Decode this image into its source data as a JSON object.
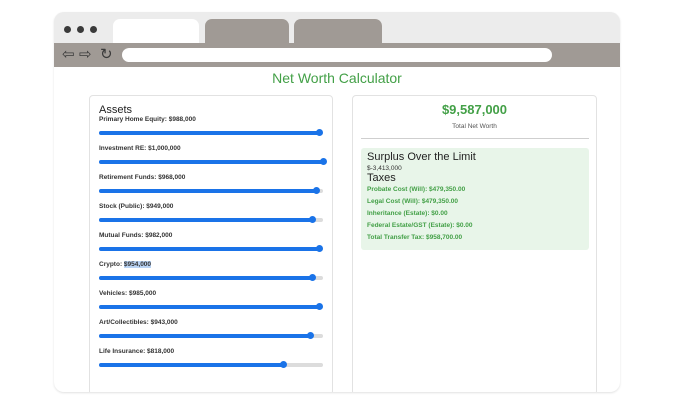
{
  "app": {
    "title": "Net Worth Calculator",
    "accent_color": "#43a047",
    "slider_color": "#1a73e8"
  },
  "browser": {
    "tabs": [
      {
        "state": "active"
      },
      {
        "state": "inactive"
      },
      {
        "state": "inactive"
      }
    ],
    "nav_icons": [
      "back-arrow-icon",
      "forward-arrow-icon",
      "reload-icon"
    ]
  },
  "assets": {
    "heading": "Assets",
    "items": [
      {
        "label": "Primary Home Equity: $988,000",
        "level": 0.98
      },
      {
        "label": "Investment RE: $1,000,000",
        "level": 1.0
      },
      {
        "label": "Retirement Funds: $968,000",
        "level": 0.97
      },
      {
        "label": "Stock (Public): $949,000",
        "level": 0.95
      },
      {
        "label": "Mutual Funds: $982,000",
        "level": 0.98
      },
      {
        "label_prefix": "Crypto: ",
        "label_highlight": "$954,000",
        "level": 0.95
      },
      {
        "label": "Vehicles: $985,000",
        "level": 0.98
      },
      {
        "label": "Art/Collectibles: $943,000",
        "level": 0.94
      },
      {
        "label": "Life Insurance: $818,000",
        "level": 0.82
      }
    ]
  },
  "summary": {
    "net_worth": "$9,587,000",
    "net_worth_label": "Total Net Worth",
    "surplus_heading": "Surplus Over the Limit",
    "surplus_value": "$-3,413,000",
    "taxes_heading": "Taxes",
    "tax_lines": [
      "Probate Cost (Will): $479,350.00",
      "Legal Cost (Will): $479,350.00",
      "Inheritance (Estate): $0.00",
      "Federal Estate/GST (Estate): $0.00",
      "Total Transfer Tax: $958,700.00"
    ]
  }
}
